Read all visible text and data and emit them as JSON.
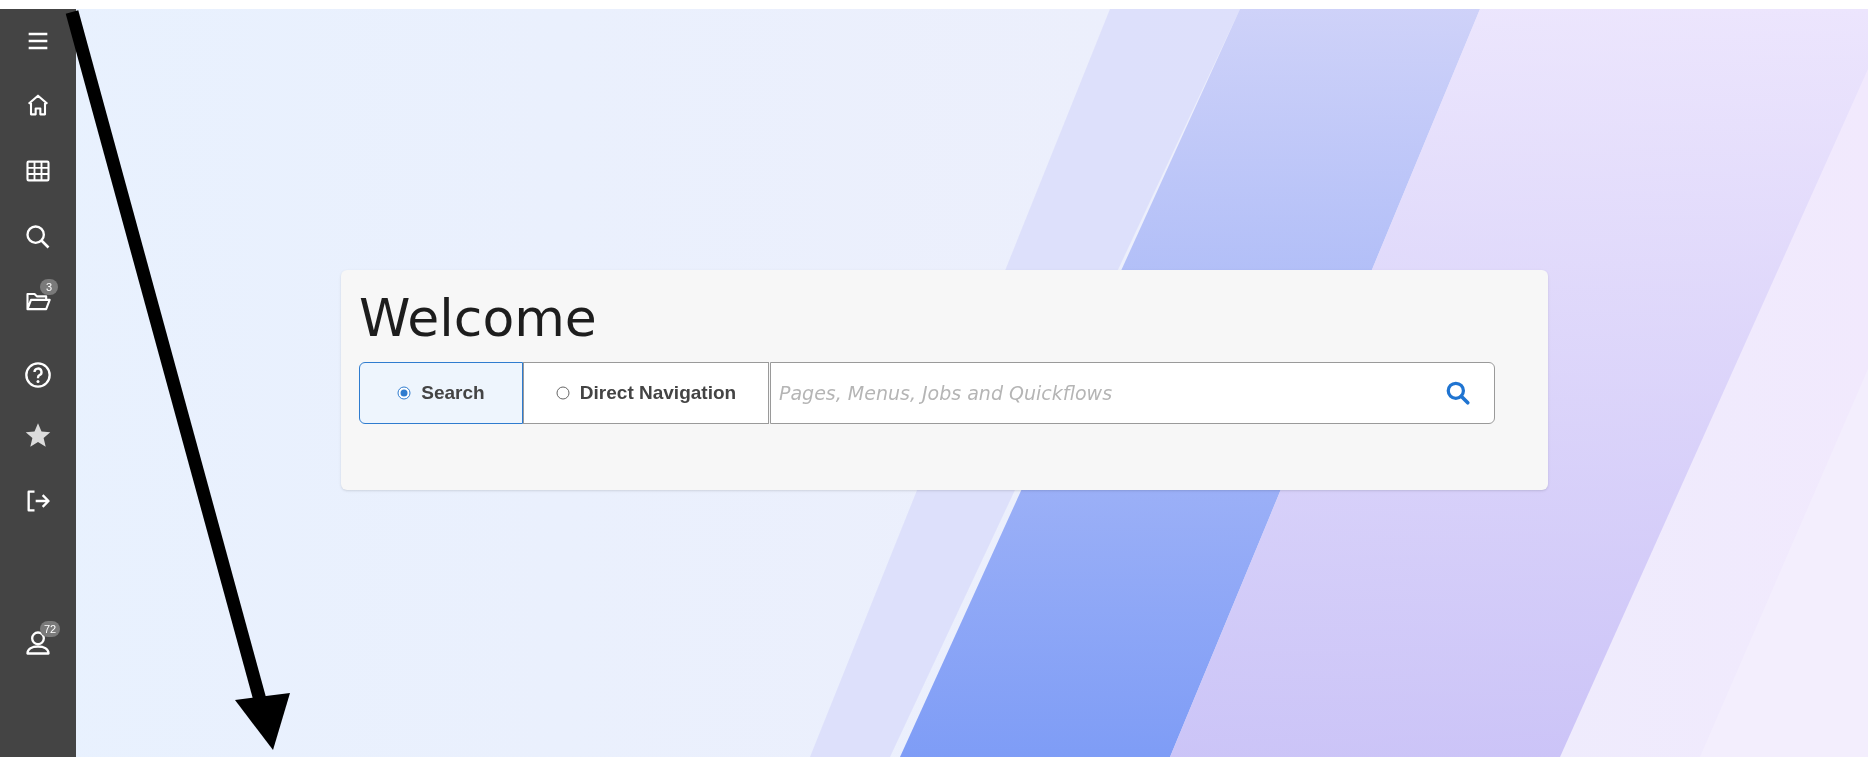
{
  "sidebar": {
    "items": [
      {
        "kind": "menu"
      },
      {
        "kind": "home"
      },
      {
        "kind": "grid"
      },
      {
        "kind": "search"
      },
      {
        "kind": "folder",
        "badge": "3"
      },
      {
        "kind": "help"
      },
      {
        "kind": "star"
      },
      {
        "kind": "signout"
      },
      {
        "kind": "user",
        "badge": "72"
      }
    ]
  },
  "welcome": {
    "title": "Welcome",
    "modes": [
      {
        "label": "Search",
        "selected": true
      },
      {
        "label": "Direct Navigation",
        "selected": false
      }
    ],
    "search": {
      "placeholder": "Pages, Menus, Jobs and Quickflows"
    }
  }
}
